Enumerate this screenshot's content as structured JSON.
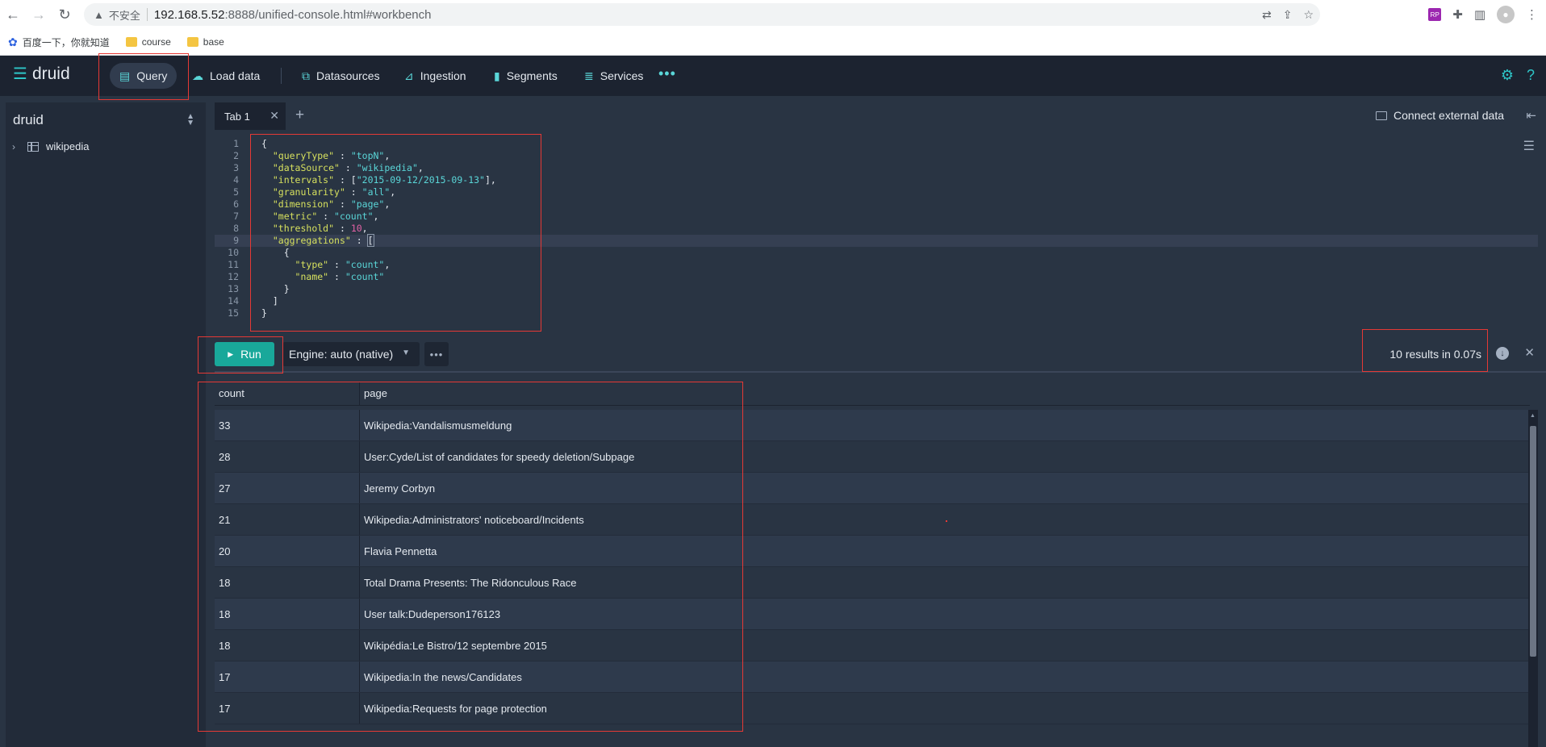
{
  "browser": {
    "insecure_label": "不安全",
    "url_host": "192.168.5.52",
    "url_path": ":8888/unified-console.html#workbench",
    "ext_badge": "RP"
  },
  "bookmarks": [
    {
      "label": "百度一下，你就知道",
      "icon": "baidu-paw-icon"
    },
    {
      "label": "course",
      "icon": "folder-icon"
    },
    {
      "label": "base",
      "icon": "folder-icon"
    }
  ],
  "header": {
    "logo": "druid",
    "nav": {
      "query": "Query",
      "load_data": "Load data",
      "datasources": "Datasources",
      "ingestion": "Ingestion",
      "segments": "Segments",
      "services": "Services",
      "more": "•••"
    },
    "accent_color": "#2ec6c8"
  },
  "sidebar": {
    "title": "druid",
    "items": [
      {
        "label": "wikipedia",
        "icon": "table-icon"
      }
    ]
  },
  "tabs": [
    {
      "label": "Tab 1"
    }
  ],
  "tabbar": {
    "add_label": "+",
    "connect_label": "Connect external data"
  },
  "editor": {
    "line_numbers": [
      "1",
      "2",
      "3",
      "4",
      "5",
      "6",
      "7",
      "8",
      "9",
      "10",
      "11",
      "12",
      "13",
      "14",
      "15"
    ],
    "active_line": 9
  },
  "toolbar": {
    "run_label": "Run",
    "engine_label": "Engine: auto (native)",
    "more_label": "•••",
    "result_summary": "10 results in 0.07s",
    "run_color": "#19a89a"
  },
  "results": {
    "columns": [
      "count",
      "page"
    ],
    "rows": [
      {
        "count": "33",
        "page": "Wikipedia:Vandalismusmeldung"
      },
      {
        "count": "28",
        "page": "User:Cyde/List of candidates for speedy deletion/Subpage"
      },
      {
        "count": "27",
        "page": "Jeremy Corbyn"
      },
      {
        "count": "21",
        "page": "Wikipedia:Administrators' noticeboard/Incidents"
      },
      {
        "count": "20",
        "page": "Flavia Pennetta"
      },
      {
        "count": "18",
        "page": "Total Drama Presents: The Ridonculous Race"
      },
      {
        "count": "18",
        "page": "User talk:Dudeperson176123"
      },
      {
        "count": "18",
        "page": "Wikipédia:Le Bistro/12 septembre 2015"
      },
      {
        "count": "17",
        "page": "Wikipedia:In the news/Candidates"
      },
      {
        "count": "17",
        "page": "Wikipedia:Requests for page protection"
      }
    ]
  }
}
